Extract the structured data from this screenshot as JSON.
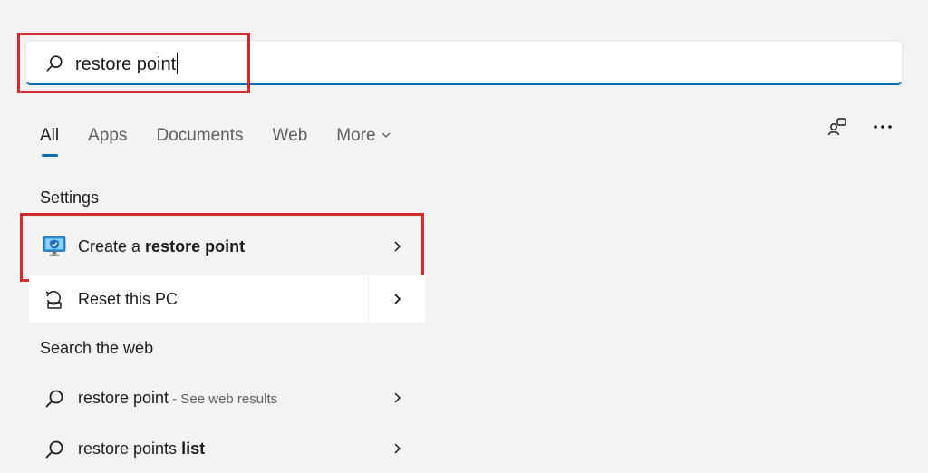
{
  "search": {
    "value": "restore point"
  },
  "tabs": [
    {
      "label": "All",
      "active": true
    },
    {
      "label": "Apps",
      "active": false
    },
    {
      "label": "Documents",
      "active": false
    },
    {
      "label": "Web",
      "active": false
    },
    {
      "label": "More",
      "active": false
    }
  ],
  "sections": {
    "settings_title": "Settings",
    "web_title": "Search the web"
  },
  "settings_results": [
    {
      "prefix": "Create a ",
      "bold": "restore point",
      "icon": "monitor-shield-icon"
    },
    {
      "prefix": "Reset this PC",
      "bold": "",
      "icon": "reset-pc-icon"
    }
  ],
  "web_results": [
    {
      "prefix": "restore point",
      "bold": "",
      "sub": " - See web results"
    },
    {
      "prefix": "restore points ",
      "bold": "list",
      "sub": ""
    }
  ],
  "colors": {
    "accent": "#0b6cb5",
    "highlight": "#d12b2b",
    "background": "#f3f3f3"
  }
}
